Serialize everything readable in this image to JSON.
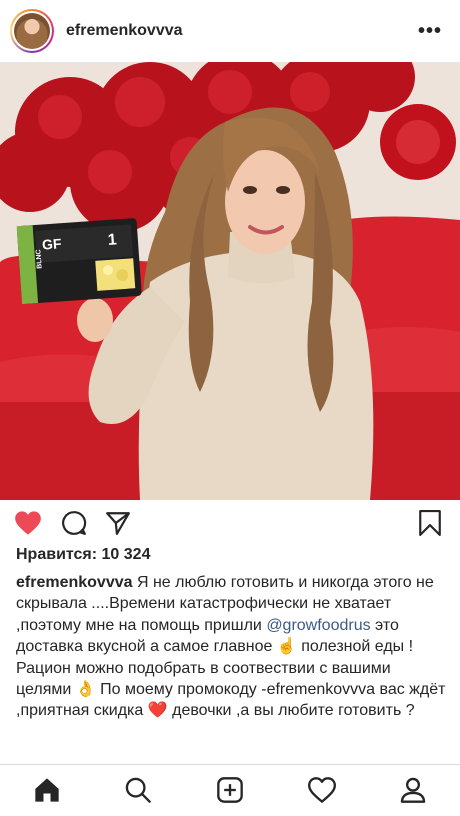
{
  "post": {
    "username": "efremenkovvva",
    "more_label": "•••",
    "likes_text": "Нравится: 10 324",
    "caption": {
      "author": "efremenkovvva",
      "text_1": " Я не люблю готовить и никогда этого не скрывала ....Времени катастрофически не хватает ,поэтому мне на помощь пришли ",
      "mention": "@growfoodrus",
      "text_2": " это доставка вкусной а самое главное ☝️ полезной еды !Рацион можно подобрать в соотвествии с вашими целями 👌 По моему промокоду -efremenkovvva вас ждёт ,приятная скидка ❤️ девочки ,а вы любите готовить ?"
    },
    "photo": {
      "package_brand": "GF",
      "package_side": "BLNC",
      "package_number": "1"
    }
  },
  "colors": {
    "like_red": "#ed4956",
    "mention_blue": "#3b5a84",
    "sofa_red": "#d8232e"
  },
  "icons": [
    "heart-icon",
    "comment-icon",
    "share-icon",
    "bookmark-icon",
    "home-icon",
    "search-icon",
    "add-post-icon",
    "activity-icon",
    "profile-icon"
  ]
}
